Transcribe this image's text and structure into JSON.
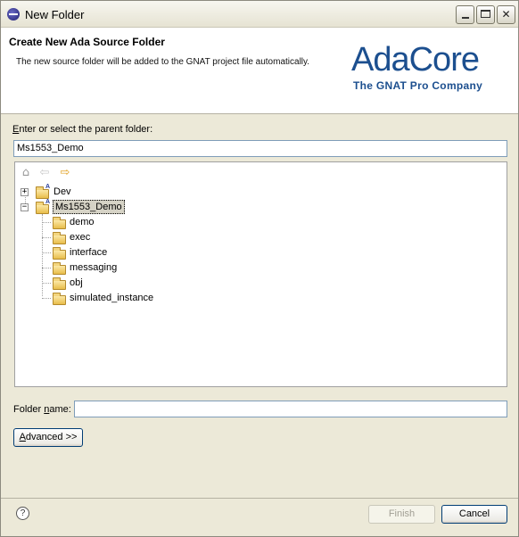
{
  "window": {
    "title": "New Folder"
  },
  "header": {
    "title": "Create New Ada Source Folder",
    "description": "The new source folder will be added to the GNAT project file automatically.",
    "logo_main": "AdaCore",
    "logo_sub": "The GNAT Pro Company"
  },
  "parent": {
    "label": "Enter or select the parent folder:",
    "value": "Ms1553_Demo"
  },
  "tree": {
    "nav_icons": [
      "home-icon",
      "back-arrow-icon",
      "forward-arrow-icon"
    ],
    "projects": [
      {
        "label": "Dev",
        "expander": "+"
      },
      {
        "label": "Ms1553_Demo",
        "expander": "−"
      }
    ],
    "children": [
      "demo",
      "exec",
      "interface",
      "messaging",
      "obj",
      "simulated_instance"
    ]
  },
  "folder_name": {
    "label": "Folder name:",
    "value": ""
  },
  "advanced_button": "Advanced >>",
  "buttons": {
    "finish": "Finish",
    "cancel": "Cancel",
    "help": "?"
  },
  "colors": {
    "logo": "#1c4f8f",
    "dialog_bg": "#ece9d8"
  }
}
